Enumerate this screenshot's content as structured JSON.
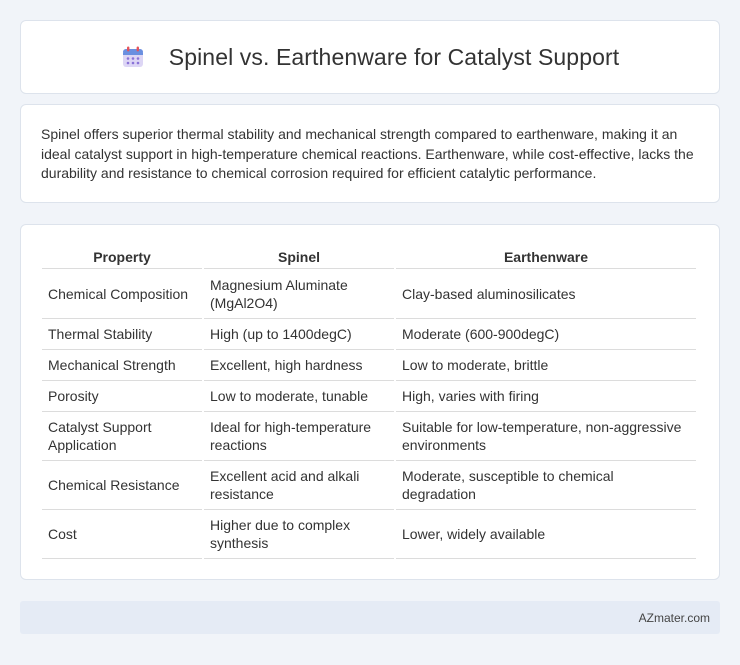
{
  "header": {
    "title": "Spinel vs. Earthenware for Catalyst Support",
    "icon": "calendar-icon"
  },
  "intro": {
    "text": "Spinel offers superior thermal stability and mechanical strength compared to earthenware, making it an ideal catalyst support in high-temperature chemical reactions. Earthenware, while cost-effective, lacks the durability and resistance to chemical corrosion required for efficient catalytic performance."
  },
  "table": {
    "headers": [
      "Property",
      "Spinel",
      "Earthenware"
    ],
    "rows": [
      [
        "Chemical Composition",
        "Magnesium Aluminate (MgAl2O4)",
        "Clay-based aluminosilicates"
      ],
      [
        "Thermal Stability",
        "High (up to 1400degC)",
        "Moderate (600-900degC)"
      ],
      [
        "Mechanical Strength",
        "Excellent, high hardness",
        "Low to moderate, brittle"
      ],
      [
        "Porosity",
        "Low to moderate, tunable",
        "High, varies with firing"
      ],
      [
        "Catalyst Support Application",
        "Ideal for high-temperature reactions",
        "Suitable for low-temperature, non-aggressive environments"
      ],
      [
        "Chemical Resistance",
        "Excellent acid and alkali resistance",
        "Moderate, susceptible to chemical degradation"
      ],
      [
        "Cost",
        "Higher due to complex synthesis",
        "Lower, widely available"
      ]
    ]
  },
  "footer": {
    "brand": "AZmater.com"
  }
}
